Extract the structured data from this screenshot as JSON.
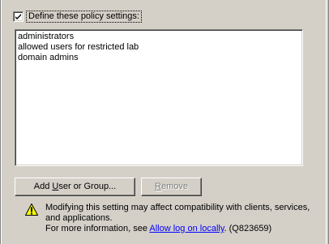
{
  "policy": {
    "define_checkbox": {
      "label": "Define these policy settings:",
      "checked": true
    }
  },
  "users_list": {
    "items": [
      "administrators",
      "allowed users for restricted lab",
      "domain admins"
    ]
  },
  "buttons": {
    "add": {
      "pre": "Add ",
      "accel": "U",
      "post": "ser or Group..."
    },
    "remove": {
      "accel": "R",
      "post": "emove",
      "enabled": false
    }
  },
  "warning": {
    "icon": "warning-icon",
    "line1": "Modifying this setting may affect compatibility with clients, services,",
    "line2": "and applications.",
    "line3_prefix": "For more information, see ",
    "link_text": "Allow log on locally",
    "line3_suffix": ". (Q823659)"
  }
}
